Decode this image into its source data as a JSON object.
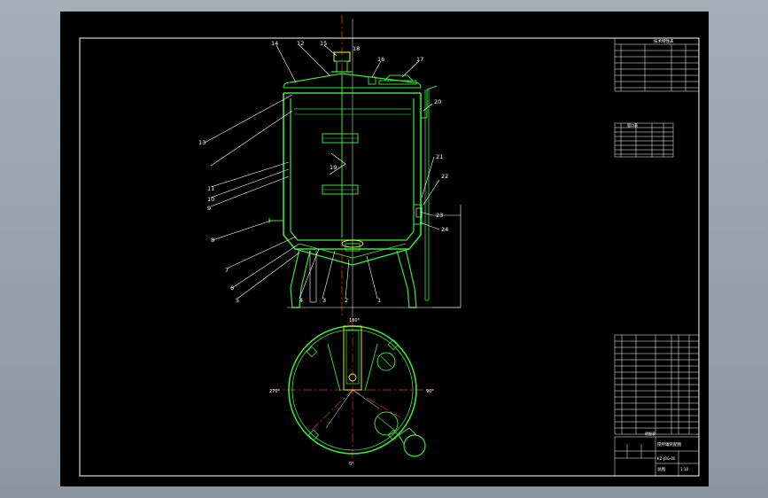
{
  "drawing": {
    "balloons": [
      "1",
      "2",
      "3",
      "4",
      "5",
      "6",
      "7",
      "8",
      "9",
      "10",
      "11",
      "12",
      "13",
      "14",
      "15",
      "16",
      "17",
      "18",
      "19",
      "20",
      "21",
      "22",
      "23",
      "24"
    ],
    "plan_marks": {
      "top": "180°",
      "left": "270°",
      "right": "90°",
      "bottom": "0°"
    }
  },
  "title_block": {
    "spec_heading": "技术特性表",
    "nozzle_heading": "管口表",
    "parts_heading": "明细表",
    "drawing_title": "搅拌罐装配图",
    "drawing_no": "KZ-JBG-00",
    "sheet_label": "总图",
    "scale": "1:10"
  }
}
